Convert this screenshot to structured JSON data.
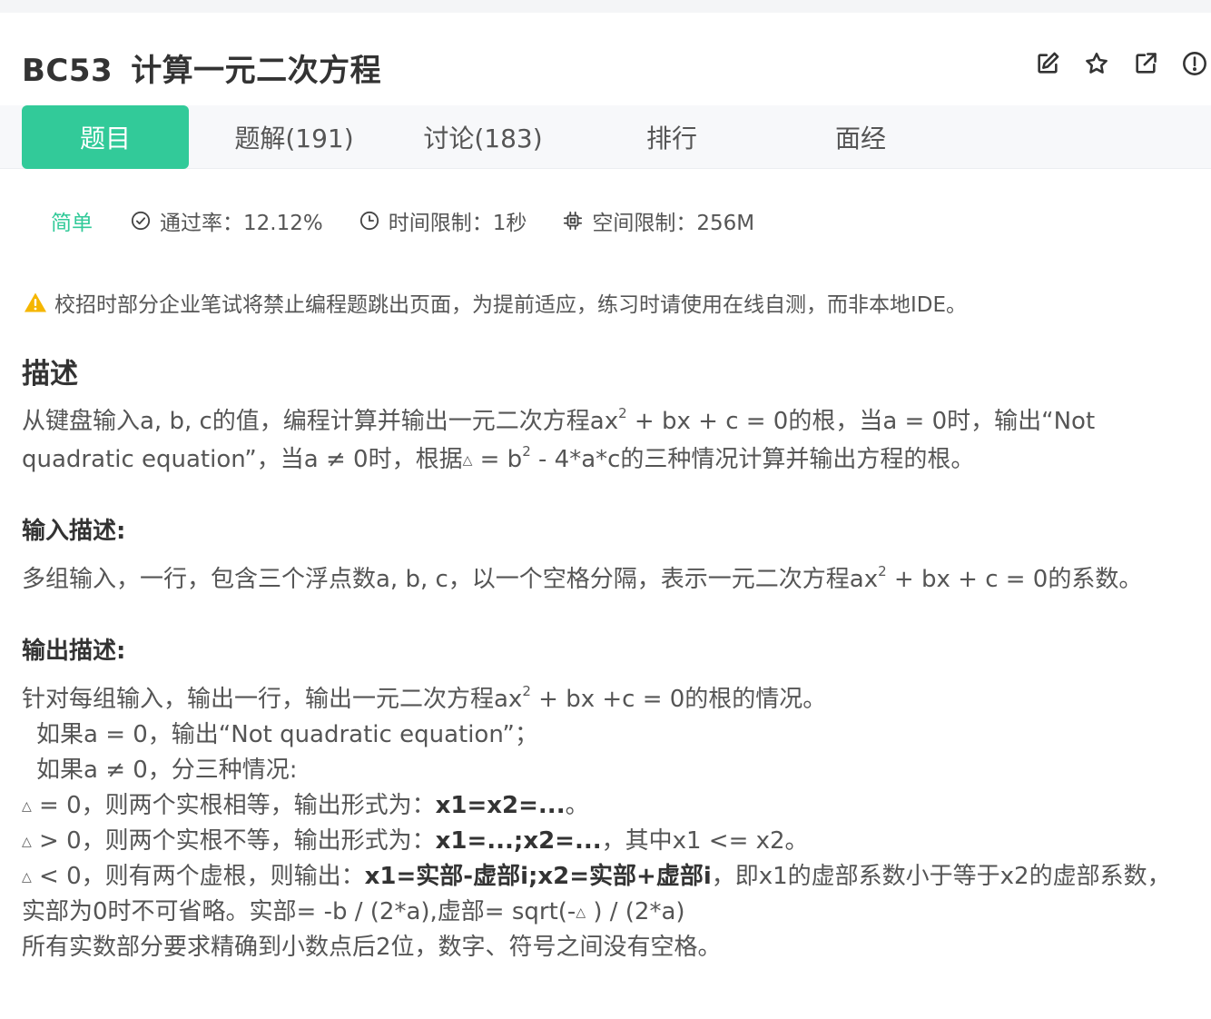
{
  "problem": {
    "code": "BC53",
    "title": "计算一元二次方程"
  },
  "actions": [
    {
      "name": "edit-icon"
    },
    {
      "name": "star-icon"
    },
    {
      "name": "share-icon"
    },
    {
      "name": "info-icon"
    }
  ],
  "tabs": [
    {
      "label": "题目",
      "active": true
    },
    {
      "label": "题解(191)"
    },
    {
      "label": "讨论(183)"
    },
    {
      "label": "排行"
    },
    {
      "label": "面经"
    }
  ],
  "meta": {
    "difficulty": "简单",
    "pass_rate": "通过率：12.12%",
    "time_limit": "时间限制：1秒",
    "space_limit": "空间限制：256M"
  },
  "notice": "校招时部分企业笔试将禁止编程题跳出页面，为提前适应，练习时请使用在线自测，而非本地IDE。",
  "sections": {
    "desc_title": "描述",
    "input_title": "输入描述:",
    "output_title": "输出描述:"
  },
  "desc": {
    "l1a": "从键盘输入a, b, c的值，编程计算并输出一元二次方程ax",
    "sup": "2",
    "l1b": " + bx + c = 0的根，当a = 0时，输出“Not",
    "l2a": "quadratic equation”，当a ≠ 0时，根据",
    "tri": "△",
    "l2b": " = b",
    "l2c": " - 4*a*c的三种情况计算并输出方程的根。"
  },
  "input": {
    "a": "多组输入，一行，包含三个浮点数a, b, c，以一个空格分隔，表示一元二次方程ax",
    "b": " + bx + c = 0的系数。"
  },
  "output": {
    "l1a": "针对每组输入，输出一行，输出一元二次方程ax",
    "l1b": " + bx +c = 0的根的情况。",
    "l2": "如果a = 0，输出“Not quadratic equation”；",
    "l3": "如果a ≠  0，分三种情况:",
    "l4a": " = 0，则两个实根相等，输出形式为：",
    "l4b": "x1=x2=...",
    "l4c": "。",
    "l5a": "  > 0，则两个实根不等，输出形式为：",
    "l5b": "x1=...;x2=...",
    "l5c": "，其中x1  <=  x2。",
    "l6a": "  < 0，则有两个虚根，则输出：",
    "l6b": "x1=实部-虚部i;x2=实部+虚部i",
    "l6c": "，即x1的虚部系数小于等于x2的虚部系数，",
    "l7a": "实部为0时不可省略。实部= -b / (2*a),虚部= sqrt(-",
    "l7b": " ) / (2*a)",
    "l8": "所有实数部分要求精确到小数点后2位，数字、符号之间没有空格。"
  }
}
